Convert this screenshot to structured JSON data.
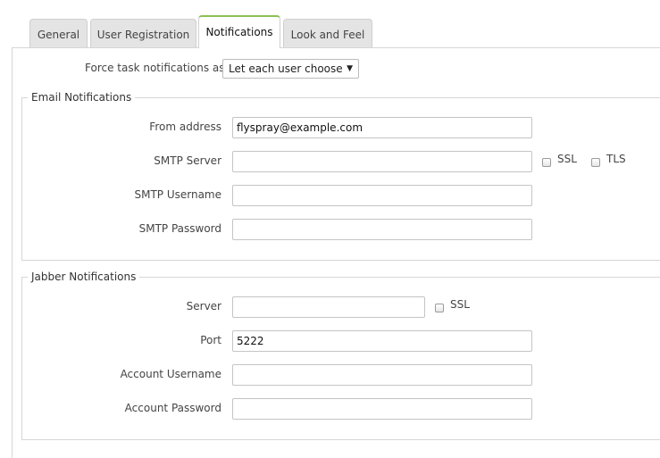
{
  "tabs": [
    {
      "label": "General",
      "active": false
    },
    {
      "label": "User Registration",
      "active": false
    },
    {
      "label": "Notifications",
      "active": true
    },
    {
      "label": "Look and Feel",
      "active": false
    }
  ],
  "force_notifications": {
    "label": "Force task notifications as",
    "selected": "Let each user choose"
  },
  "email": {
    "legend": "Email Notifications",
    "from_label": "From address",
    "from_value": "flyspray@example.com",
    "server_label": "SMTP Server",
    "server_value": "",
    "ssl_label": "SSL",
    "tls_label": "TLS",
    "username_label": "SMTP Username",
    "username_value": "",
    "password_label": "SMTP Password",
    "password_value": ""
  },
  "jabber": {
    "legend": "Jabber Notifications",
    "server_label": "Server",
    "server_value": "",
    "ssl_label": "SSL",
    "port_label": "Port",
    "port_value": "5222",
    "username_label": "Account Username",
    "username_value": "",
    "password_label": "Account Password",
    "password_value": ""
  }
}
